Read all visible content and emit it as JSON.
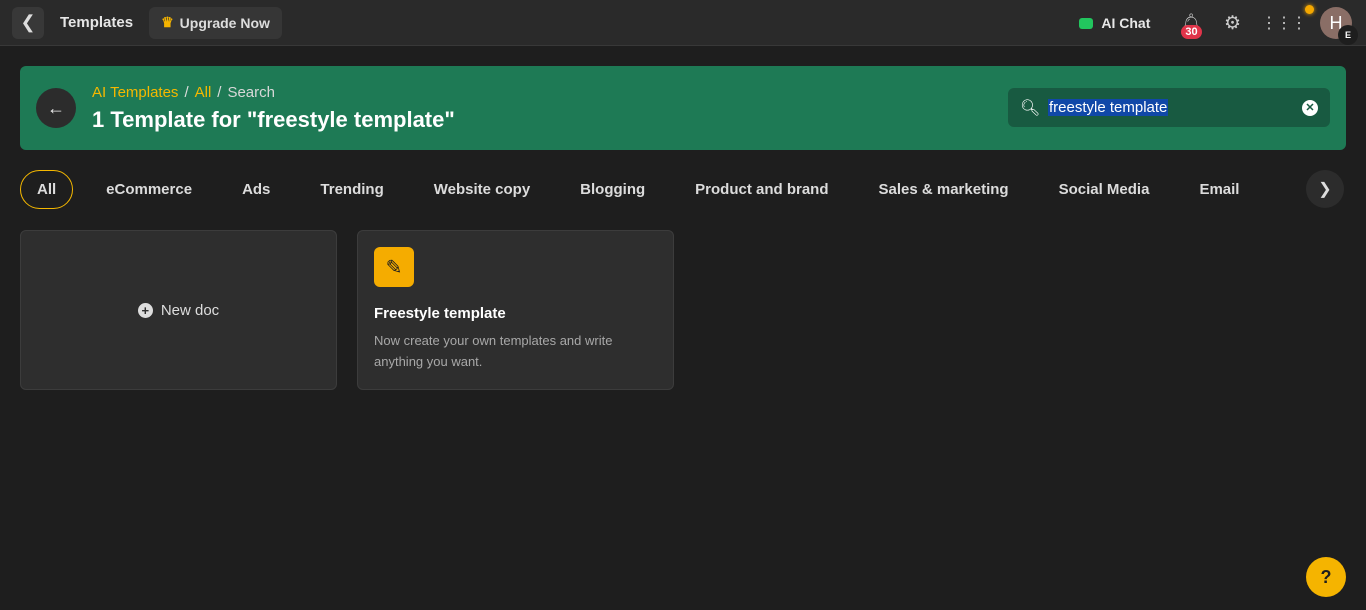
{
  "topbar": {
    "title": "Templates",
    "upgrade_label": "Upgrade Now",
    "ai_chat_label": "AI Chat",
    "notification_count": "30",
    "avatar_initial": "H",
    "avatar_sub": "E"
  },
  "banner": {
    "breadcrumb": [
      "AI Templates",
      "All",
      "Search"
    ],
    "separator": "/",
    "heading": "1 Template for \"freestyle template\"",
    "search_value": "freestyle template",
    "color": "#1e7a55"
  },
  "tabs": [
    "All",
    "eCommerce",
    "Ads",
    "Trending",
    "Website copy",
    "Blogging",
    "Product and brand",
    "Sales & marketing",
    "Social Media",
    "Email"
  ],
  "cards": {
    "new_doc_label": "New doc",
    "template": {
      "name": "Freestyle template",
      "description": "Now create your own templates and write anything you want."
    }
  },
  "help_label": "?",
  "accent": "#f5b400"
}
